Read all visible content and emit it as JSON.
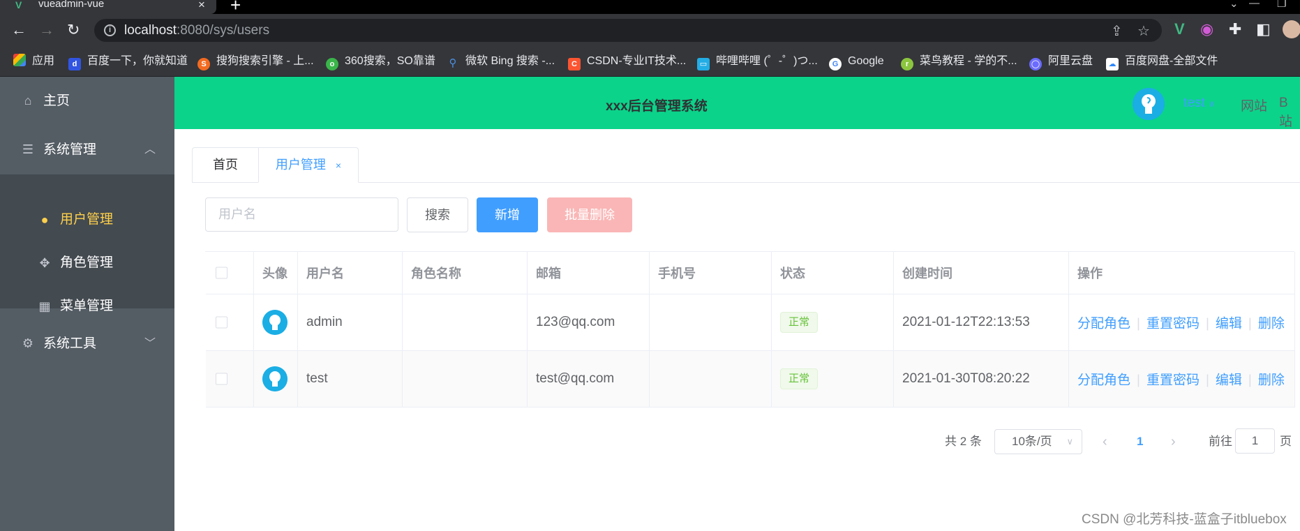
{
  "browser": {
    "tab_title": "vueadmin-vue",
    "url_host": "localhost",
    "url_rest": ":8080/sys/users",
    "bookmarks": [
      {
        "label": "应用",
        "color": "#e94235",
        "icon": "apps-icon"
      },
      {
        "label": "百度一下，你就知道",
        "color": "#3155e2",
        "icon": "baidu-icon"
      },
      {
        "label": "搜狗搜索引擎 - 上...",
        "color": "#f26b21",
        "icon": "sogou-icon"
      },
      {
        "label": "360搜索，SO靠谱",
        "color": "#3ab54a",
        "icon": "so360-icon"
      },
      {
        "label": "微软 Bing 搜索 -...",
        "color": "#1e7fd6",
        "icon": "bing-icon"
      },
      {
        "label": "CSDN-专业IT技术...",
        "color": "#fc5531",
        "icon": "csdn-icon"
      },
      {
        "label": "哔哩哔哩 (゜-゜)つ...",
        "color": "#23ade5",
        "icon": "bilibili-icon"
      },
      {
        "label": "Google",
        "color": "#4285f4",
        "icon": "google-icon"
      },
      {
        "label": "菜鸟教程 - 学的不...",
        "color": "#8cc63f",
        "icon": "runoob-icon"
      },
      {
        "label": "阿里云盘",
        "color": "#6b6bff",
        "icon": "aliyun-drive-icon"
      },
      {
        "label": "百度网盘-全部文件",
        "color": "#2f87fb",
        "icon": "baidu-pan-icon"
      }
    ]
  },
  "sidebar": {
    "home": "主页",
    "sys_manage": "系统管理",
    "sub_items": [
      "用户管理",
      "角色管理",
      "菜单管理"
    ],
    "sys_tools": "系统工具",
    "active_color": "#ffd04b",
    "bg_color": "#545c64"
  },
  "header": {
    "title": "xxx后台管理系统",
    "username": "test",
    "links": [
      "网站",
      "B站"
    ],
    "bg_color": "#0bd38a"
  },
  "tabs": {
    "home": "首页",
    "active": "用户管理",
    "close": "×"
  },
  "toolbar": {
    "search_placeholder": "用户名",
    "search_btn": "搜索",
    "add_btn": "新增",
    "batch_delete_btn": "批量删除"
  },
  "table": {
    "columns": [
      "头像",
      "用户名",
      "角色名称",
      "邮箱",
      "手机号",
      "状态",
      "创建时间",
      "操作"
    ],
    "rows": [
      {
        "username": "admin",
        "role": "",
        "email": "123@qq.com",
        "phone": "",
        "status": "正常",
        "created": "2021-01-12T22:13:53"
      },
      {
        "username": "test",
        "role": "",
        "email": "test@qq.com",
        "phone": "",
        "status": "正常",
        "created": "2021-01-30T08:20:22"
      }
    ],
    "ops": [
      "分配角色",
      "重置密码",
      "编辑",
      "删除"
    ]
  },
  "pagination": {
    "total": "共 2 条",
    "page_size": "10条/页",
    "current": "1",
    "goto_label": "前往",
    "goto_value": "1",
    "page_suffix": "页"
  },
  "watermark": "CSDN @北芳科技-蓝盒子itbluebox"
}
